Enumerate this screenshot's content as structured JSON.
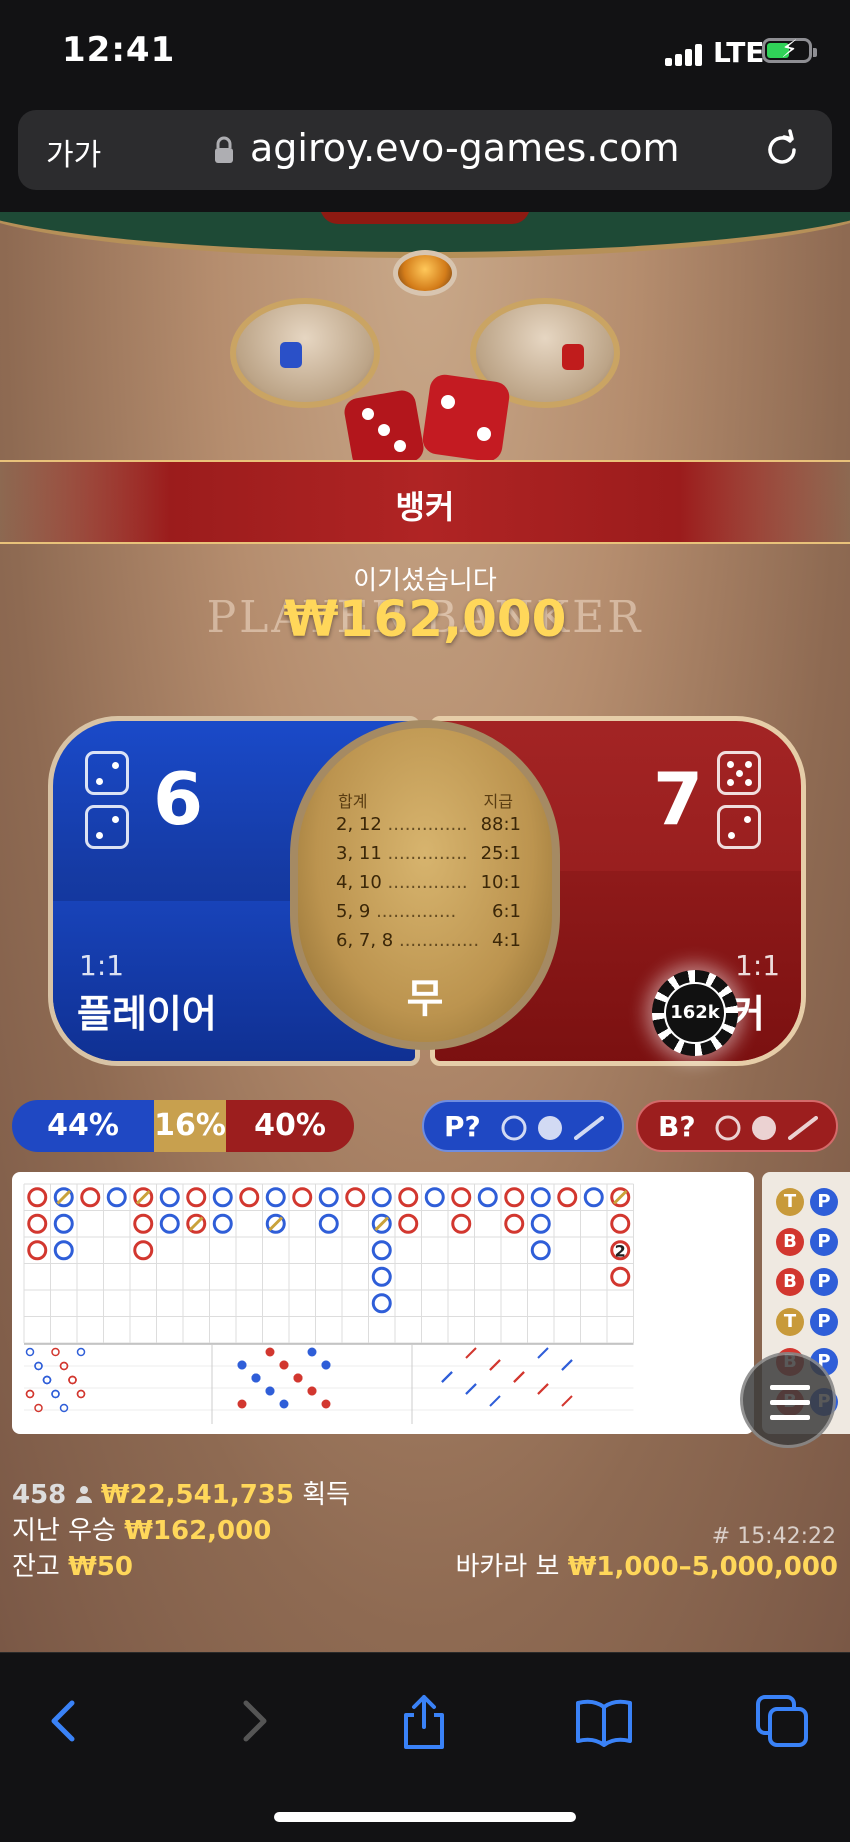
{
  "status_bar": {
    "time": "12:41",
    "network": "LTE",
    "icons": [
      "signal-icon",
      "battery-charging-icon"
    ]
  },
  "browser": {
    "aa_label": "가가",
    "url": "agiroy.evo-games.com",
    "icons": [
      "lock-icon",
      "reload-icon"
    ]
  },
  "game": {
    "win_banner": "뱅커",
    "you_won": "이기셨습니다",
    "win_amount": "₩162,000",
    "table_text": "PLAYER    BANKER",
    "player": {
      "score": "6",
      "odds": "1:1",
      "label": "플레이어"
    },
    "banker": {
      "score": "7",
      "odds": "1:1",
      "label": "뱅커"
    },
    "tie": {
      "header_left": "합계",
      "header_right": "지급",
      "rows": [
        {
          "sum": "2, 12",
          "pay": "88:1"
        },
        {
          "sum": "3, 11",
          "pay": "25:1"
        },
        {
          "sum": "4, 10",
          "pay": "10:1"
        },
        {
          "sum": "5, 9",
          "pay": "6:1"
        },
        {
          "sum": "6, 7, 8",
          "pay": "4:1"
        }
      ],
      "label": "무"
    },
    "chip_label": "162k",
    "stats": {
      "player": "44%",
      "tie": "16%",
      "banker": "40%"
    },
    "player_predict": "P?",
    "banker_predict": "B?",
    "bead_road": [
      [
        "T",
        "P"
      ],
      [
        "B",
        "P"
      ],
      [
        "B",
        "P"
      ],
      [
        "T",
        "P"
      ],
      [
        "B",
        "P"
      ],
      [
        "B",
        "P"
      ]
    ],
    "big_road_tie_count": "2"
  },
  "info": {
    "players": "458",
    "total_won": "₩22,541,735",
    "won_label": "획득",
    "last_win_label": "지난 우승",
    "last_win": "₩162,000",
    "game_id": "# 15:42:22",
    "balance_label": "잔고",
    "balance": "₩50",
    "table_label": "바카라 보",
    "limits": "₩1,000–5,000,000"
  },
  "colors": {
    "player_blue": "#1a4ac9",
    "banker_red": "#a32424",
    "gold": "#ffd75a"
  }
}
